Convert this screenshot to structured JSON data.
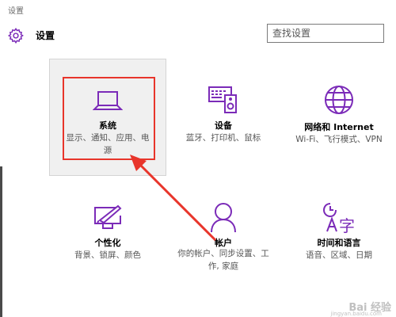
{
  "window": {
    "title": "设置"
  },
  "header": {
    "app_name": "设置",
    "search_placeholder": "查找设置"
  },
  "colors": {
    "accent": "#7b2bb8",
    "highlight_box": "#e8352b",
    "arrow": "#e8352b"
  },
  "tiles": [
    {
      "title": "系统",
      "desc_line1": "显示、通知、应用、电",
      "desc_line2": "源",
      "icon": "laptop-icon"
    },
    {
      "title": "设备",
      "desc_line1": "蓝牙、打印机、鼠标",
      "desc_line2": "",
      "icon": "devices-icon"
    },
    {
      "title": "网络和 Internet",
      "desc_line1": "Wi-Fi、飞行模式、VPN",
      "desc_line2": "",
      "icon": "globe-icon"
    },
    {
      "title": "个性化",
      "desc_line1": "背景、锁屏、颜色",
      "desc_line2": "",
      "icon": "personalization-icon"
    },
    {
      "title": "帐户",
      "desc_line1": "你的帐户、同步设置、工",
      "desc_line2": "作, 家庭",
      "icon": "person-icon"
    },
    {
      "title": "时间和语言",
      "desc_line1": "语音、区域、日期",
      "desc_line2": "",
      "icon": "time-language-icon"
    }
  ],
  "watermark": {
    "text": "Bai 经验",
    "sub": "jingyan.baidu.com"
  }
}
